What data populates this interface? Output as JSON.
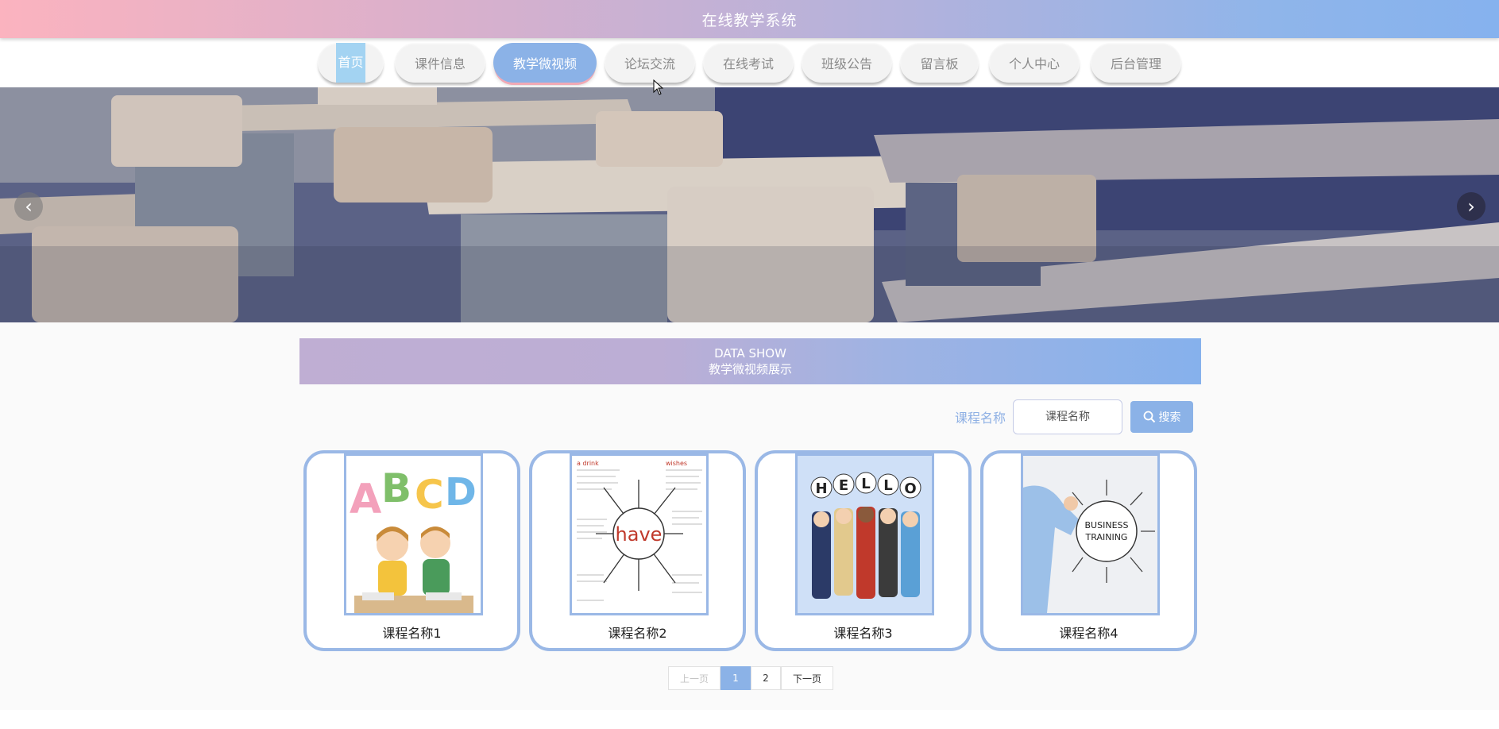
{
  "header": {
    "title": "在线教学系统"
  },
  "nav": {
    "items": [
      {
        "label": "首页"
      },
      {
        "label": "课件信息"
      },
      {
        "label": "教学微视频"
      },
      {
        "label": "论坛交流"
      },
      {
        "label": "在线考试"
      },
      {
        "label": "班级公告"
      },
      {
        "label": "留言板"
      },
      {
        "label": "个人中心"
      },
      {
        "label": "后台管理"
      }
    ],
    "active": "教学微视频"
  },
  "banner": {
    "prev_icon": "chevron-left-icon",
    "next_icon": "chevron-right-icon"
  },
  "section": {
    "title_en": "DATA SHOW",
    "title_cn": "教学微视频展示"
  },
  "search": {
    "label": "课程名称",
    "placeholder": "课程名称",
    "button_label": "搜索",
    "button_icon": "search-icon"
  },
  "cards": [
    {
      "name": "课程名称1",
      "image": "abcd-kids-illustration"
    },
    {
      "name": "课程名称2",
      "image": "have-word-map-illustration",
      "image_text": "have"
    },
    {
      "name": "课程名称3",
      "image": "hello-people-illustration",
      "image_text": "HELLO"
    },
    {
      "name": "课程名称4",
      "image": "business-training-illustration",
      "image_text": "BUSINESS TRAINING"
    }
  ],
  "pagination": {
    "prev": "上一页",
    "pages": [
      "1",
      "2"
    ],
    "current": "1",
    "next": "下一页"
  },
  "colors": {
    "accent": "#8bb2e7",
    "header_gradient_start": "#fbb3bf",
    "header_gradient_end": "#86b2ee",
    "card_border": "#9ab8e6"
  }
}
